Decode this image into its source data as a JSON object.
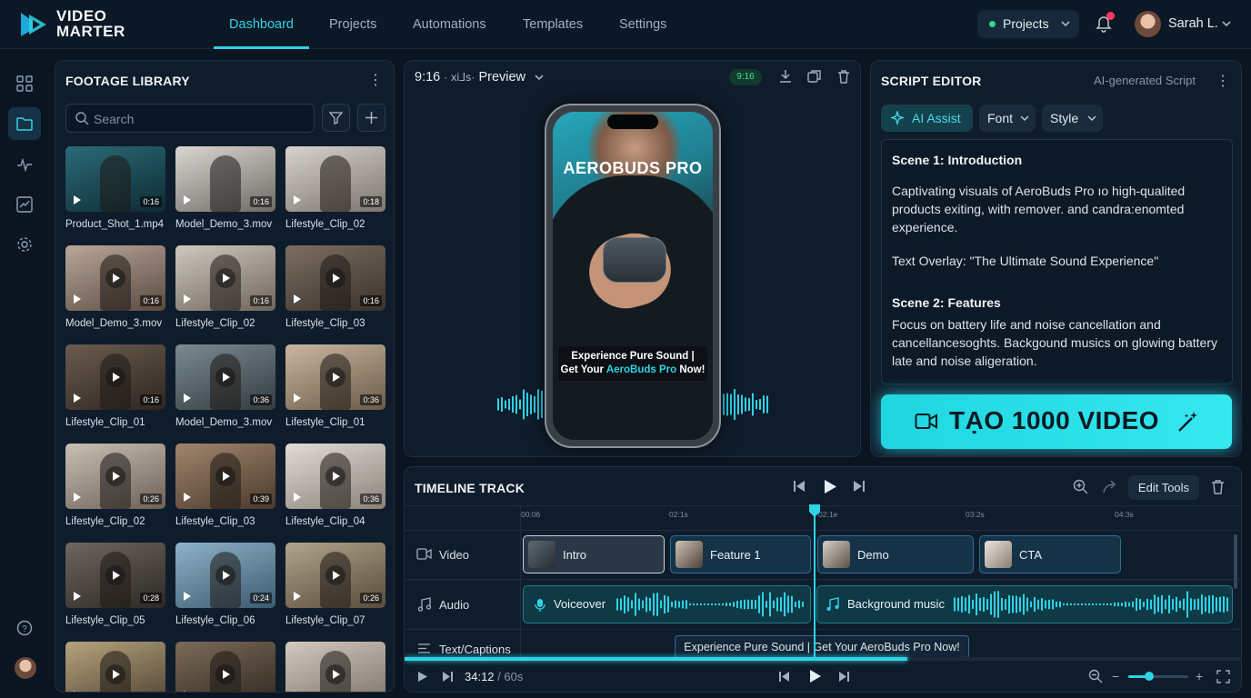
{
  "app": {
    "name_line1": "VIDEO",
    "name_line2": "MARTER"
  },
  "nav": {
    "tabs": [
      "Dashboard",
      "Projects",
      "Automations",
      "Templates",
      "Settings"
    ]
  },
  "header": {
    "projects_label": "Projects",
    "user_name": "Sarah L."
  },
  "library": {
    "title": "FOOTAGE LIBRARY",
    "search_placeholder": "Search",
    "items": [
      {
        "name": "Product_Shot_1.mp4",
        "duration": "0:16"
      },
      {
        "name": "Model_Demo_3.mov",
        "duration": "0:16"
      },
      {
        "name": "Lifestyle_Clip_02",
        "duration": "0:18"
      },
      {
        "name": "Model_Demo_3.mov",
        "duration": "0:16"
      },
      {
        "name": "Lifestyle_Clip_02",
        "duration": "0:16"
      },
      {
        "name": "Lifestyle_Clip_03",
        "duration": "0:16"
      },
      {
        "name": "Lifestyle_Clip_01",
        "duration": "0:16"
      },
      {
        "name": "Model_Demo_3.mov",
        "duration": "0:36"
      },
      {
        "name": "Lifestyle_Clip_01",
        "duration": "0:36"
      },
      {
        "name": "Lifestyle_Clip_02",
        "duration": "0:26"
      },
      {
        "name": "Lifestyle_Clip_03",
        "duration": "0:39"
      },
      {
        "name": "Lifestyle_Clip_04",
        "duration": "0:36"
      },
      {
        "name": "Lifestyle_Clip_05",
        "duration": "0:28"
      },
      {
        "name": "Lifestyle_Clip_06",
        "duration": "0:24"
      },
      {
        "name": "Lifestyle_Clip_07",
        "duration": "0:26"
      },
      {
        "name": "",
        "duration": ""
      },
      {
        "name": "",
        "duration": ""
      },
      {
        "name": "",
        "duration": ""
      }
    ]
  },
  "preview": {
    "ratio": "9:16",
    "ratio_note": "· ⅺ⅃ꜱ·",
    "label": "Preview",
    "badge": "9:16",
    "phone_title": "AEROBUDS PRO",
    "caption_line1": "Experience Pure Sound |",
    "caption_line2_prefix": "Get Your ",
    "caption_line2_highlight": "AeroBuds Pro",
    "caption_line2_suffix": " Now!"
  },
  "script": {
    "title": "SCRIPT EDITOR",
    "subtitle": "AI-generated Script",
    "ai_assist": "AI Assist",
    "font": "Font",
    "style": "Style",
    "scene1_title": "Scene 1: Introduction",
    "scene1_body": "Captivating visuals of AeroBuds Pro ıo high-qualited products exiting, with remover. and candra:enomted experience.",
    "scene1_overlay": "Text Overlay: \"The Ultimate Sound Experience\"",
    "scene2_title": "Scene 2: Features",
    "scene2_body": "Focus on battery life and noise cancellation and cancellancesoghts. Backgound musics on glowing battery late and noise aligeration.",
    "cta": "TẠO 1000 VIDEO"
  },
  "timeline": {
    "title": "TIMELINE TRACK",
    "edit_tools": "Edit Tools",
    "ticks": [
      "00:06",
      "02:1s",
      "02:1e",
      "03:2s",
      "04:3s"
    ],
    "tracks": {
      "video": "Video",
      "audio": "Audio",
      "text": "Text/Captions"
    },
    "clips": [
      "Intro",
      "Feature 1",
      "Demo",
      "CTA"
    ],
    "audio_clips": [
      "Voiceover",
      "Background music"
    ],
    "caption_clip": "Experience Pure Sound | Get Your AeroBuds Pro Now!",
    "time_current": "34:12",
    "time_total": " / 60s",
    "playhead_progress": 0.6,
    "zoom_level": 0.35
  },
  "colors": {
    "accent": "#2ed3e6",
    "background": "#0b1522",
    "panel": "#0f1c2b"
  }
}
